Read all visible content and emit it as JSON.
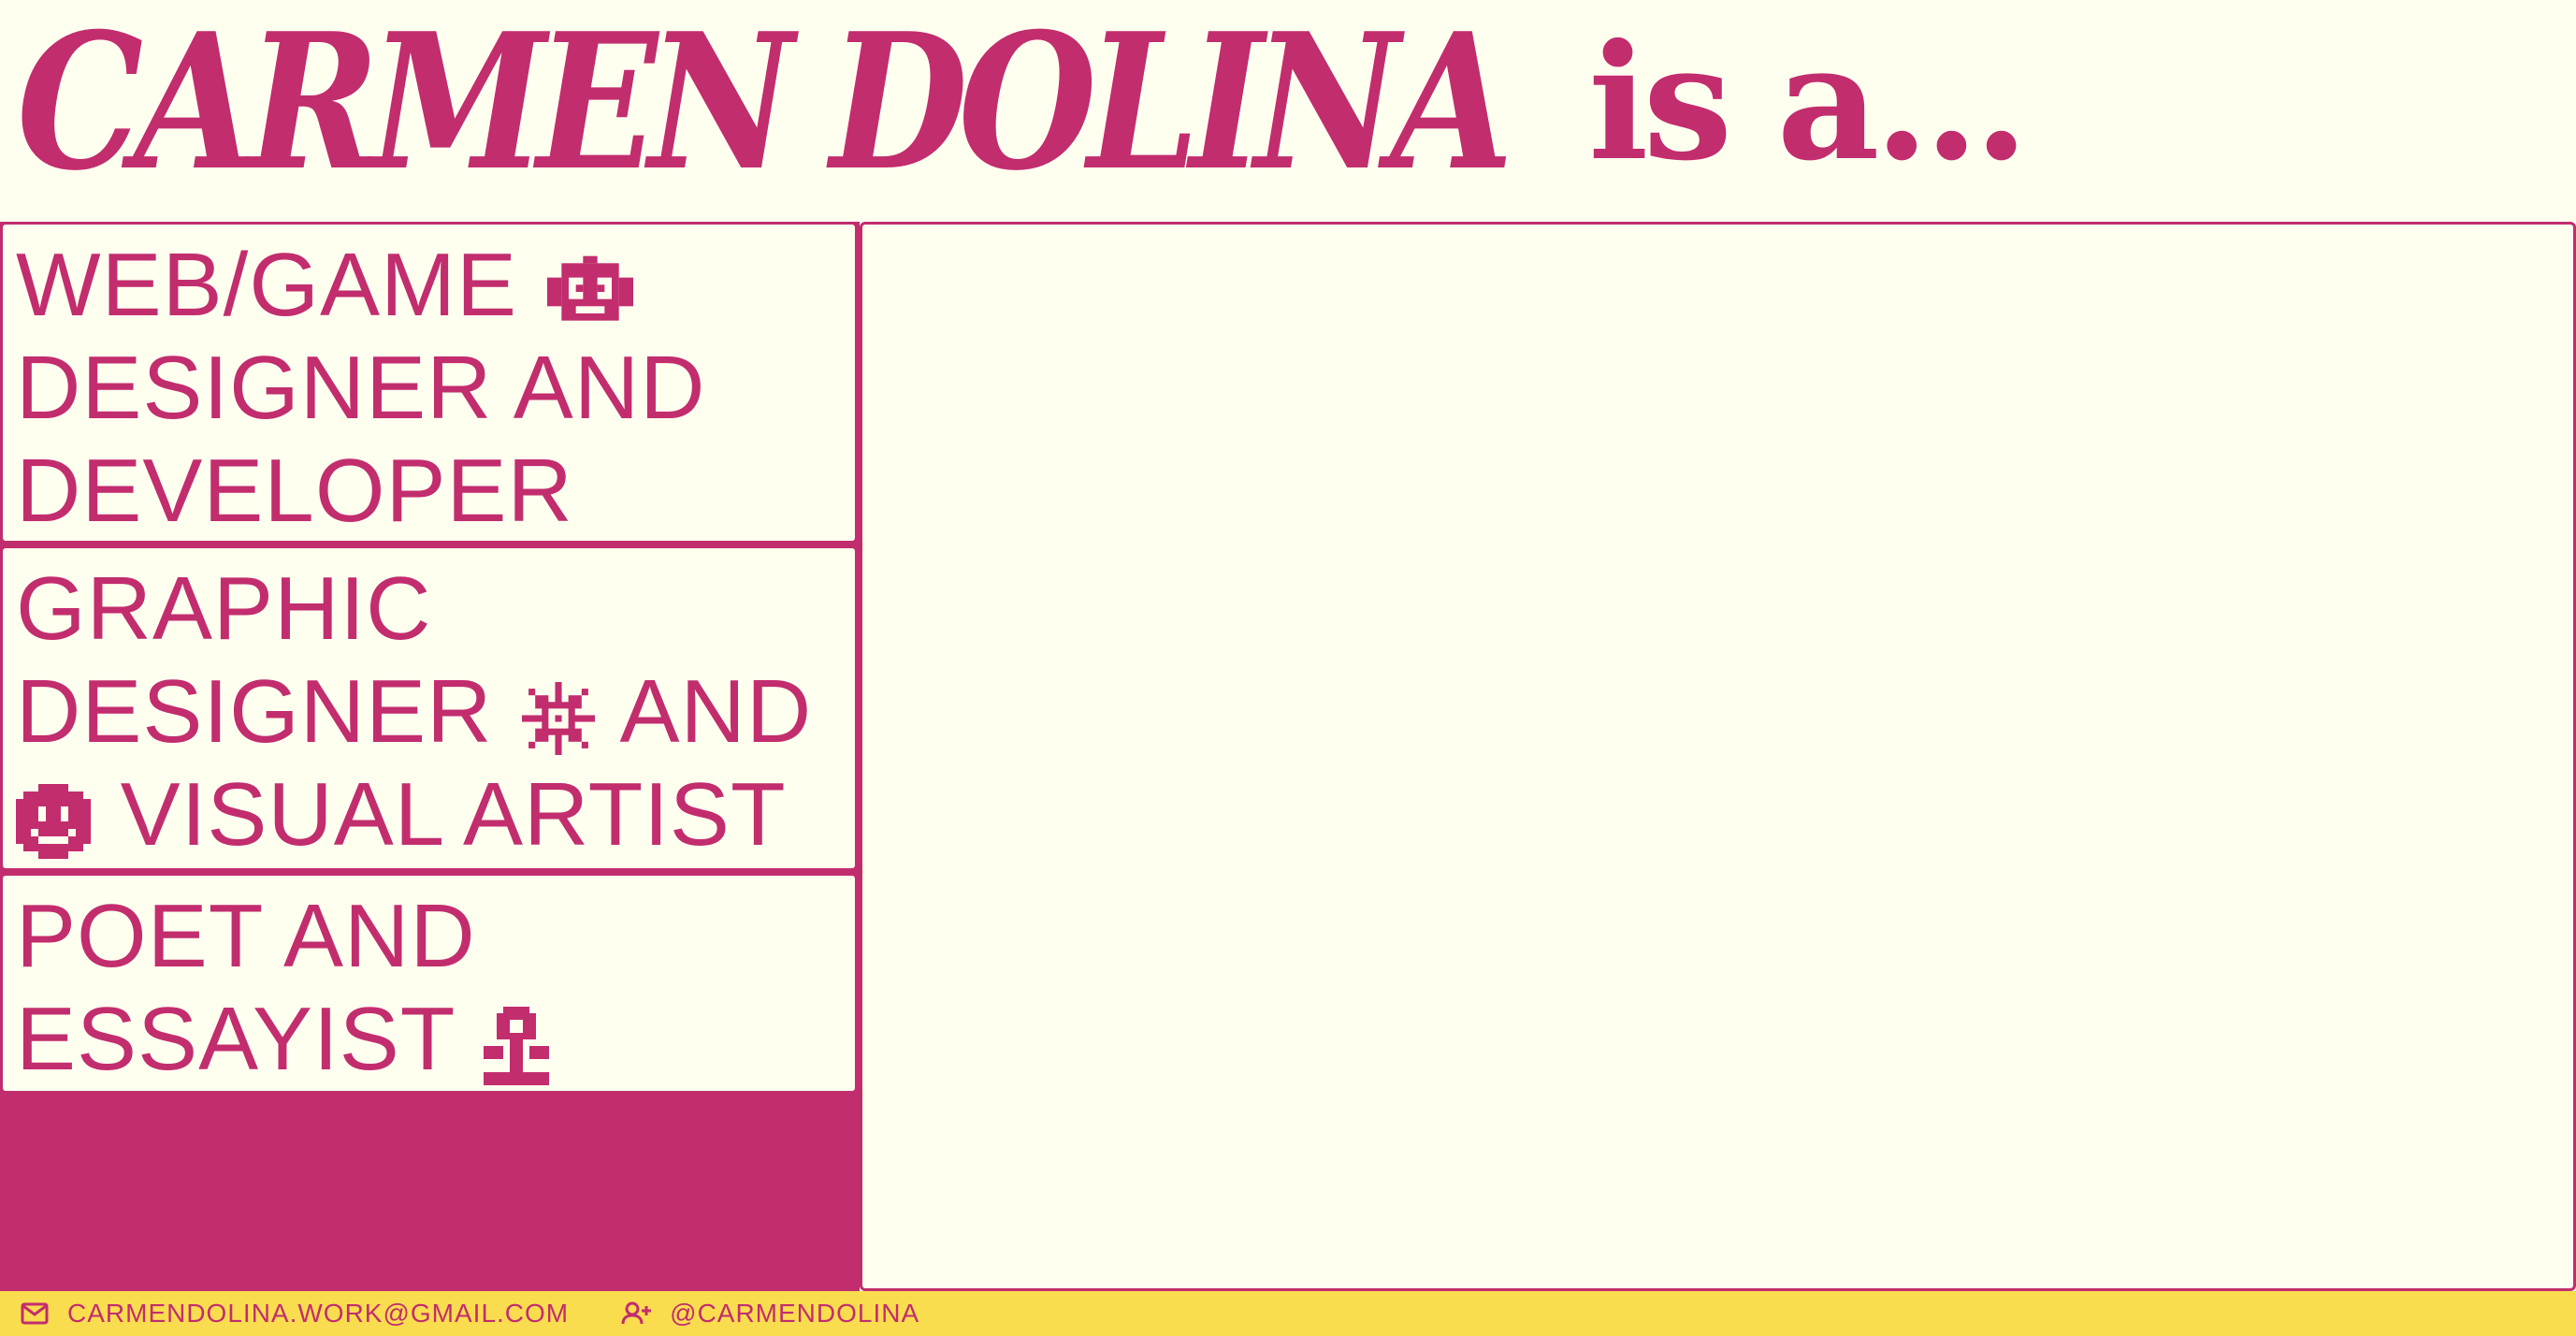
{
  "header": {
    "name": "CARMEN DOLINA",
    "suffix": "is a..."
  },
  "roles": [
    {
      "line1": "WEB/GAME",
      "line2": "DESIGNER AND",
      "line3": "DEVELOPER",
      "icon": "robot-icon"
    },
    {
      "line1": "GRAPHIC",
      "line2a": "DESIGNER",
      "line2b": "AND",
      "line3": "VISUAL ARTIST",
      "icons": [
        "sparkle-icon",
        "smiley-icon"
      ]
    },
    {
      "line1": "POET AND",
      "line2": "ESSAYIST",
      "icon": "flower-icon"
    }
  ],
  "footer": {
    "email": "CARMENDOLINA.WORK@GMAIL.COM",
    "handle": "@CARMENDOLINA",
    "email_icon": "mail-icon",
    "handle_icon": "user-plus-icon"
  },
  "colors": {
    "accent": "#c22d6e",
    "background": "#fffff0",
    "footer": "#fadd4f"
  }
}
